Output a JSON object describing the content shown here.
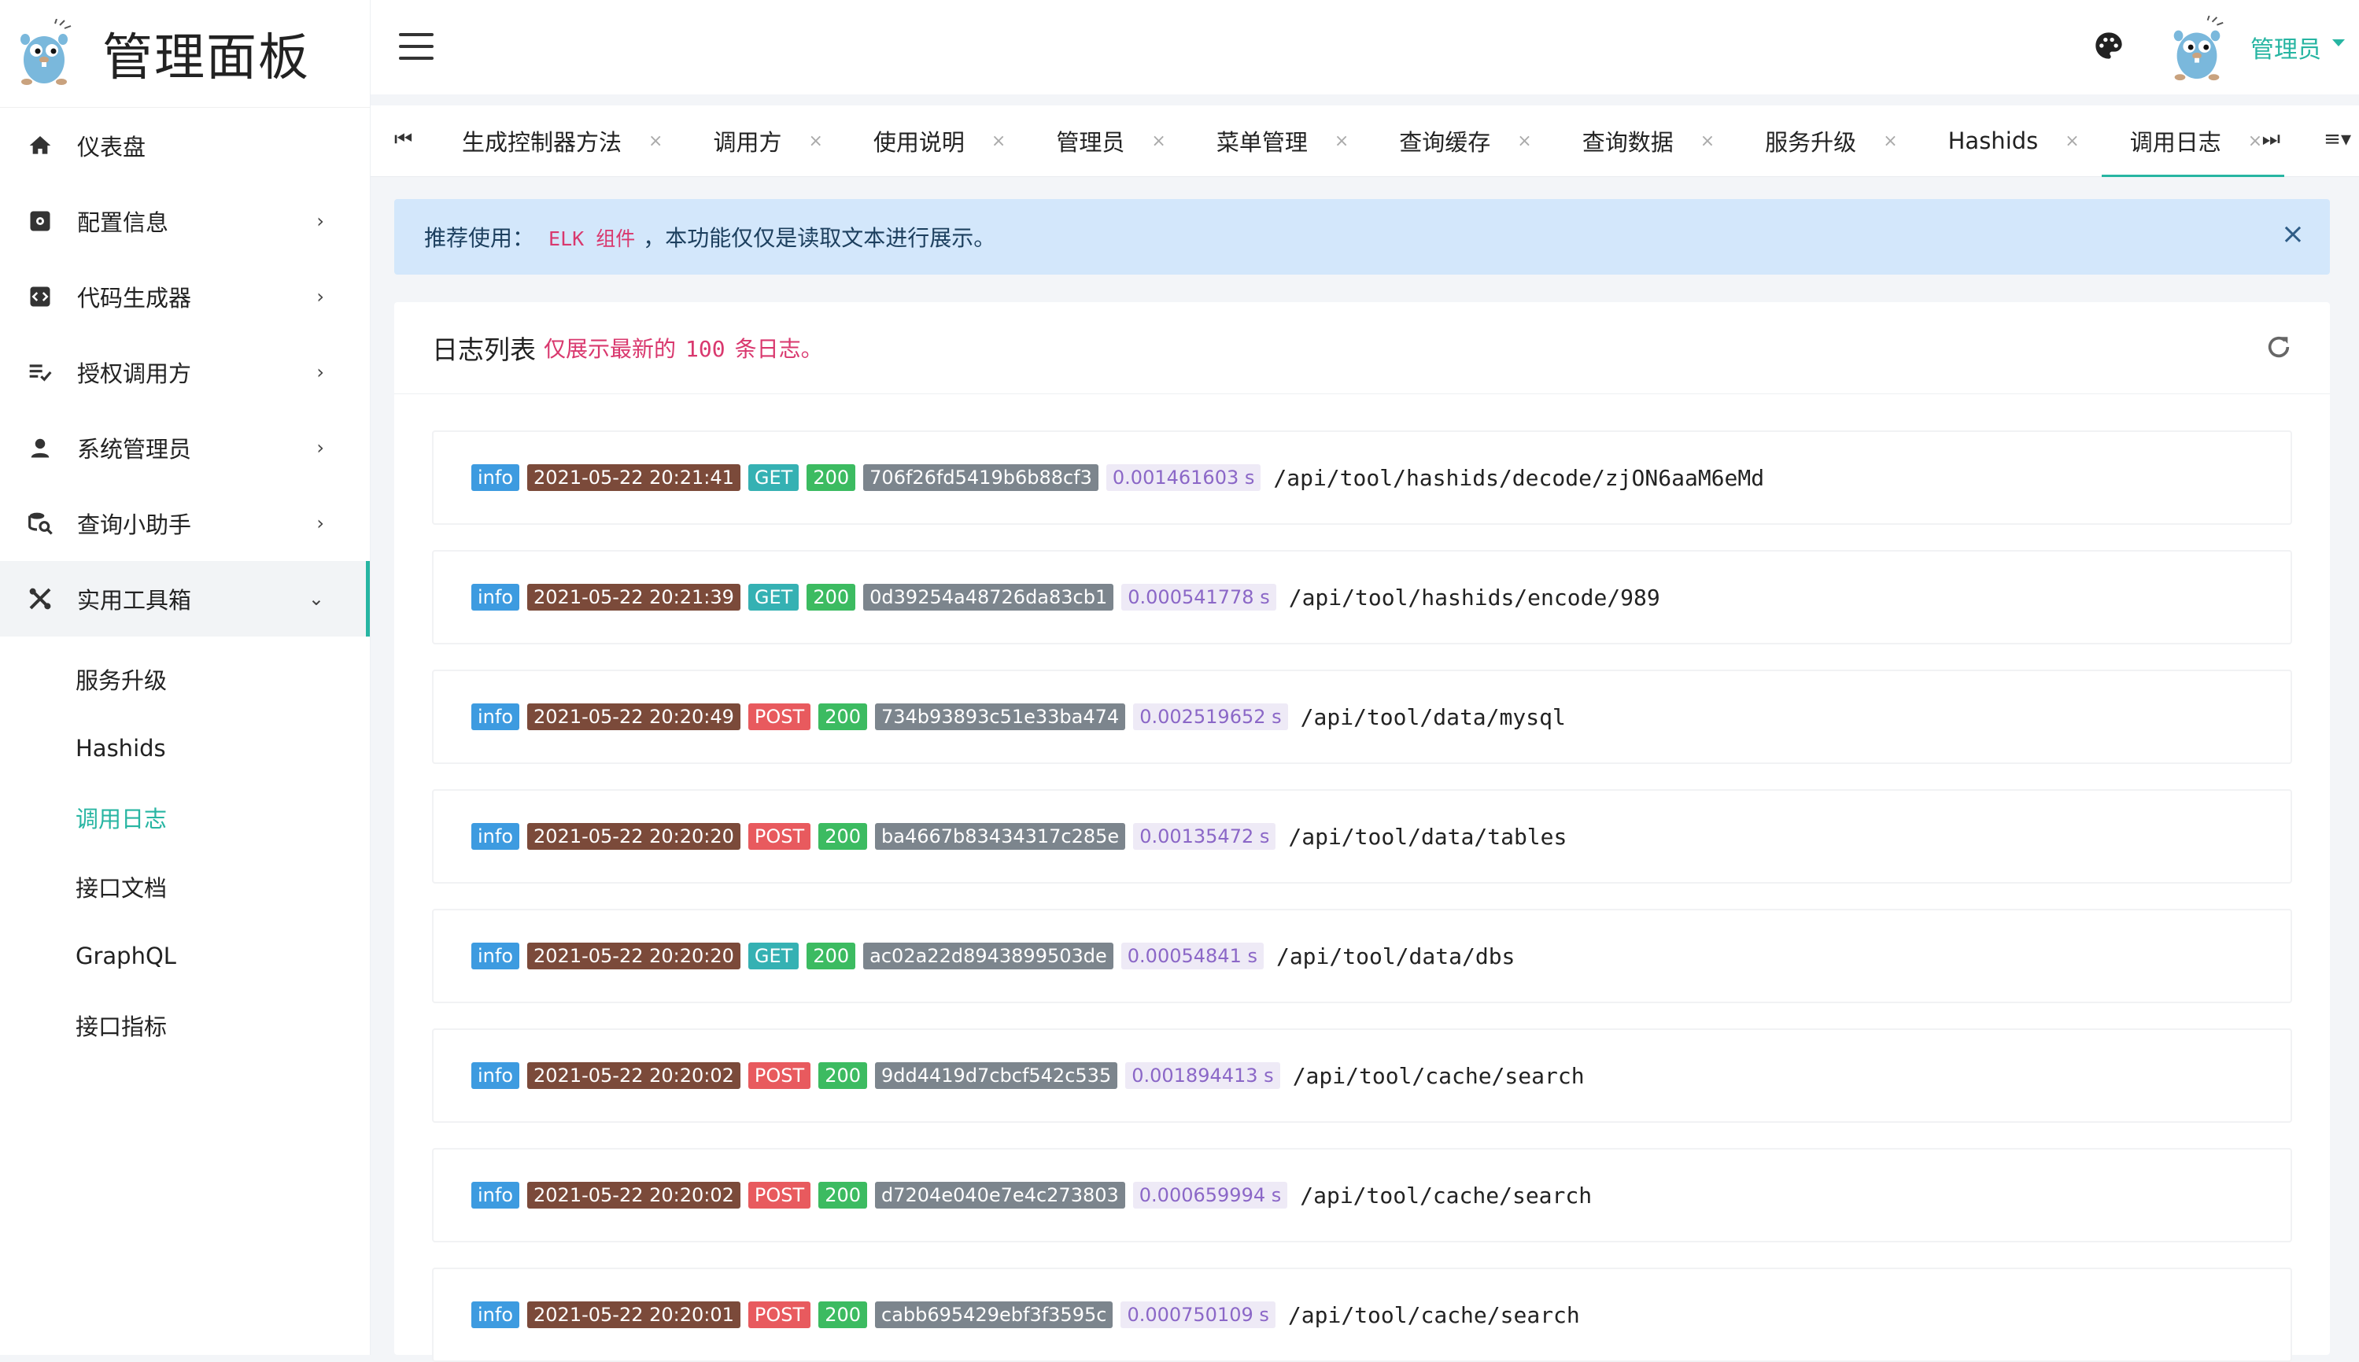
{
  "brand": {
    "title": "管理面板",
    "logo_icon": "gopher-logo"
  },
  "sidebar": {
    "items": [
      {
        "label": "仪表盘",
        "icon": "home-icon"
      },
      {
        "label": "配置信息",
        "icon": "settings-box-icon"
      },
      {
        "label": "代码生成器",
        "icon": "code-icon"
      },
      {
        "label": "授权调用方",
        "icon": "playlist-check-icon"
      },
      {
        "label": "系统管理员",
        "icon": "user-icon"
      },
      {
        "label": "查询小助手",
        "icon": "search-db-icon"
      },
      {
        "label": "实用工具箱",
        "icon": "tools-icon"
      }
    ],
    "submenu": [
      {
        "label": "服务升级"
      },
      {
        "label": "Hashids"
      },
      {
        "label": "调用日志"
      },
      {
        "label": "接口文档"
      },
      {
        "label": "GraphQL"
      },
      {
        "label": "接口指标"
      }
    ]
  },
  "header": {
    "user_name": "管理员"
  },
  "tabs": [
    {
      "label": "生成控制器方法"
    },
    {
      "label": "调用方"
    },
    {
      "label": "使用说明"
    },
    {
      "label": "管理员"
    },
    {
      "label": "菜单管理"
    },
    {
      "label": "查询缓存"
    },
    {
      "label": "查询数据"
    },
    {
      "label": "服务升级"
    },
    {
      "label": "Hashids"
    },
    {
      "label": "调用日志"
    }
  ],
  "alert": {
    "prefix": "推荐使用：",
    "link": "ELK 组件",
    "suffix": "，本功能仅仅是读取文本进行展示。",
    "close": "×"
  },
  "card": {
    "title": "日志列表",
    "sub_prefix": "仅展示最新的",
    "sub_count": "100",
    "sub_suffix": "条日志。"
  },
  "logs": [
    {
      "level": "info",
      "time": "2021-05-22 20:21:41",
      "method": "GET",
      "status": "200",
      "trace_id": "706f26fd5419b6b88cf3",
      "duration": "0.001461603 s",
      "path": "/api/tool/hashids/decode/zjON6aaM6eMd"
    },
    {
      "level": "info",
      "time": "2021-05-22 20:21:39",
      "method": "GET",
      "status": "200",
      "trace_id": "0d39254a48726da83cb1",
      "duration": "0.000541778 s",
      "path": "/api/tool/hashids/encode/989"
    },
    {
      "level": "info",
      "time": "2021-05-22 20:20:49",
      "method": "POST",
      "status": "200",
      "trace_id": "734b93893c51e33ba474",
      "duration": "0.002519652 s",
      "path": "/api/tool/data/mysql"
    },
    {
      "level": "info",
      "time": "2021-05-22 20:20:20",
      "method": "POST",
      "status": "200",
      "trace_id": "ba4667b83434317c285e",
      "duration": "0.00135472 s",
      "path": "/api/tool/data/tables"
    },
    {
      "level": "info",
      "time": "2021-05-22 20:20:20",
      "method": "GET",
      "status": "200",
      "trace_id": "ac02a22d8943899503de",
      "duration": "0.00054841 s",
      "path": "/api/tool/data/dbs"
    },
    {
      "level": "info",
      "time": "2021-05-22 20:20:02",
      "method": "POST",
      "status": "200",
      "trace_id": "9dd4419d7cbcf542c535",
      "duration": "0.001894413 s",
      "path": "/api/tool/cache/search"
    },
    {
      "level": "info",
      "time": "2021-05-22 20:20:02",
      "method": "POST",
      "status": "200",
      "trace_id": "d7204e040e7e4c273803",
      "duration": "0.000659994 s",
      "path": "/api/tool/cache/search"
    },
    {
      "level": "info",
      "time": "2021-05-22 20:20:01",
      "method": "POST",
      "status": "200",
      "trace_id": "cabb695429ebf3f3595c",
      "duration": "0.000750109 s",
      "path": "/api/tool/cache/search"
    }
  ],
  "colors": {
    "accent": "#27b5a2",
    "alert_bg": "#d3e7fb",
    "highlight": "#d9386e"
  }
}
